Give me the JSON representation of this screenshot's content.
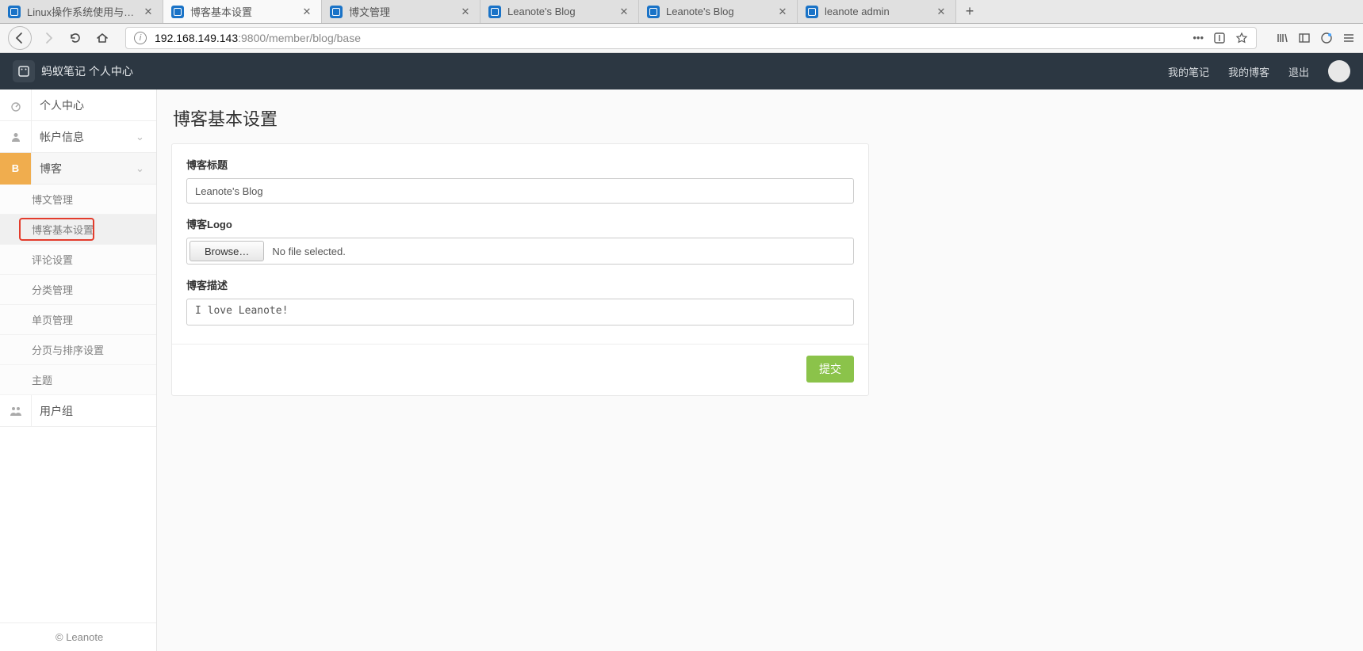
{
  "browser": {
    "tabs": [
      {
        "title": "Linux操作系统使用与命令",
        "active": false
      },
      {
        "title": "博客基本设置",
        "active": true
      },
      {
        "title": "博文管理",
        "active": false
      },
      {
        "title": "Leanote's Blog",
        "active": false
      },
      {
        "title": "Leanote's Blog",
        "active": false
      },
      {
        "title": "leanote admin",
        "active": false
      }
    ],
    "url_host": "192.168.149.143",
    "url_rest": ":9800/member/blog/base"
  },
  "header": {
    "brand": "蚂蚁笔记 个人中心",
    "links": {
      "notes": "我的笔记",
      "blog": "我的博客",
      "logout": "退出"
    }
  },
  "sidebar": {
    "personal": "个人中心",
    "account": "帐户信息",
    "blog": "博客",
    "blog_icon": "B",
    "submenu": [
      "博文管理",
      "博客基本设置",
      "评论设置",
      "分类管理",
      "单页管理",
      "分页与排序设置",
      "主题"
    ],
    "usergroup": "用户组",
    "footer": "© Leanote"
  },
  "page": {
    "title": "博客基本设置",
    "labels": {
      "blog_title": "博客标题",
      "blog_logo": "博客Logo",
      "blog_desc": "博客描述"
    },
    "values": {
      "blog_title": "Leanote's Blog",
      "blog_desc": "I love Leanote!"
    },
    "file": {
      "browse": "Browse…",
      "status": "No file selected."
    },
    "submit": "提交"
  }
}
